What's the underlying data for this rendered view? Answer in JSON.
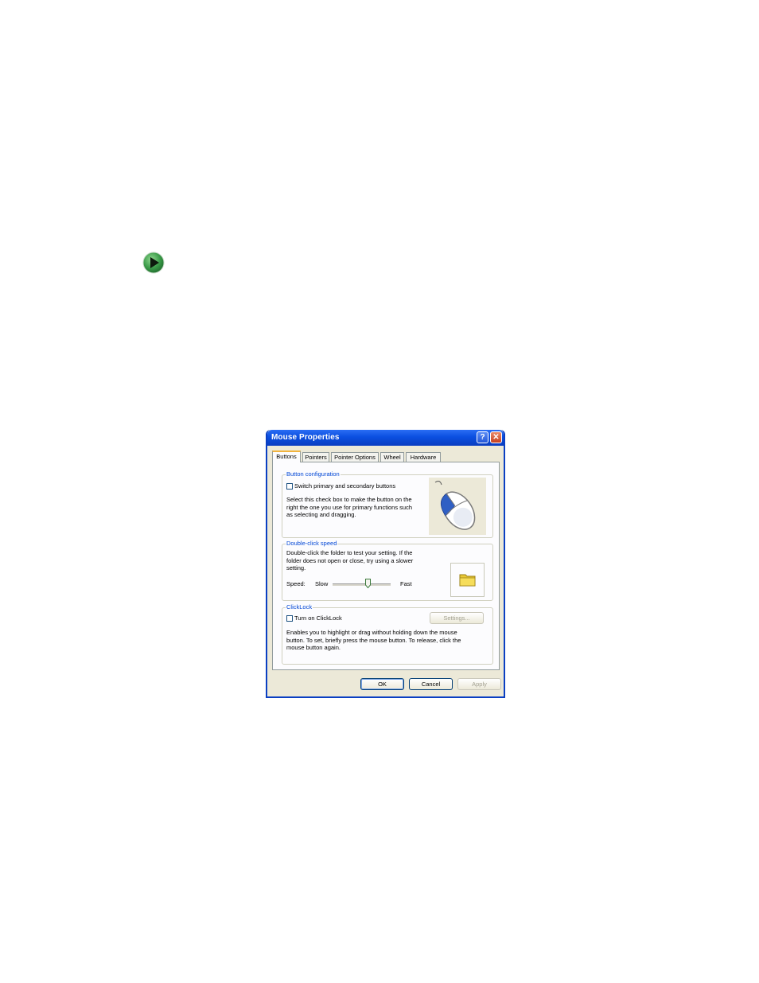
{
  "window": {
    "title": "Mouse Properties",
    "help_glyph": "?",
    "close_glyph": "✕"
  },
  "tabs": [
    {
      "label": "Buttons",
      "active": true
    },
    {
      "label": "Pointers"
    },
    {
      "label": "Pointer Options"
    },
    {
      "label": "Wheel"
    },
    {
      "label": "Hardware"
    }
  ],
  "button_configuration": {
    "legend": "Button configuration",
    "checkbox_label": "Switch primary and secondary buttons",
    "checked": false,
    "description": [
      "Select this check box to make the button on the",
      "right the one you use for primary functions such",
      "as selecting and dragging."
    ]
  },
  "double_click": {
    "legend": "Double-click speed",
    "description": [
      "Double-click the folder to test your setting. If the",
      "folder does not open or close, try using a slower",
      "setting."
    ],
    "speed_label": "Speed:",
    "slow_label": "Slow",
    "fast_label": "Fast",
    "slider_value_fraction": 0.6
  },
  "clicklock": {
    "legend": "ClickLock",
    "checkbox_label": "Turn on ClickLock",
    "checked": false,
    "settings_label": "Settings...",
    "description": [
      "Enables you to highlight or drag without holding down the mouse",
      "button. To set, briefly press the mouse button. To release, click the",
      "mouse button again."
    ]
  },
  "footer": {
    "ok_label": "OK",
    "cancel_label": "Cancel",
    "apply_label": "Apply"
  },
  "icons": {
    "bullet": "green-arrow-icon",
    "mouse": "mouse-icon",
    "folder": "folder-icon"
  },
  "colors": {
    "titlebar": "#0b4fe0",
    "group_legend": "#0046d5",
    "close": "#c6401f",
    "bullet": "#2f8a3c"
  }
}
